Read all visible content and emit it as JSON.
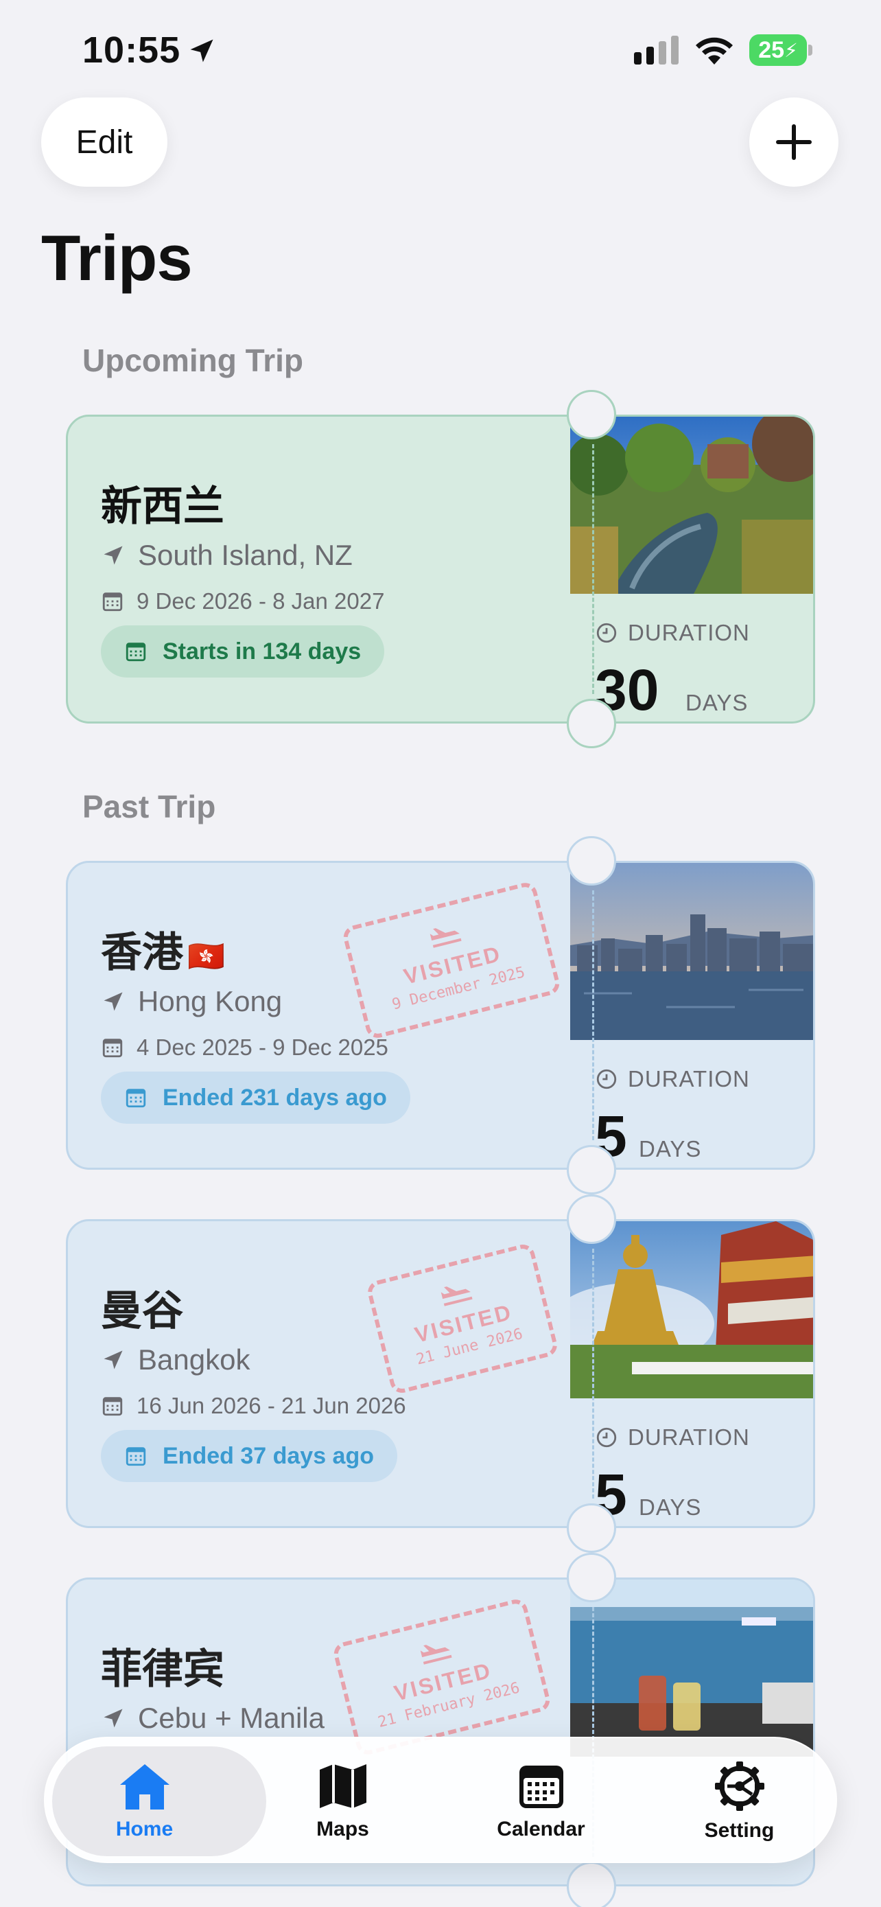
{
  "status_bar": {
    "time": "10:55",
    "battery": "25"
  },
  "header": {
    "edit_label": "Edit",
    "title": "Trips"
  },
  "sections": {
    "upcoming": "Upcoming Trip",
    "past": "Past Trip"
  },
  "upcoming_trip": {
    "name": "新西兰",
    "location": "South Island, NZ",
    "dates": "9 Dec 2026 - 8 Jan 2027",
    "status": "Starts in 134 days",
    "duration_label": "DURATION",
    "duration_value": "30",
    "duration_unit": "DAYS"
  },
  "past_trips": [
    {
      "name": "香港",
      "flag": "🇭🇰",
      "location": "Hong Kong",
      "dates": "4 Dec 2025 - 9 Dec 2025",
      "status": "Ended 231 days ago",
      "stamp_title": "VISITED",
      "stamp_date": "9 December 2025",
      "duration_label": "DURATION",
      "duration_value": "5",
      "duration_unit": "DAYS"
    },
    {
      "name": "曼谷",
      "location": "Bangkok",
      "dates": "16 Jun 2026 - 21 Jun 2026",
      "status": "Ended 37 days ago",
      "stamp_title": "VISITED",
      "stamp_date": "21 June 2026",
      "duration_label": "DURATION",
      "duration_value": "5",
      "duration_unit": "DAYS"
    },
    {
      "name": "菲律宾",
      "location": "Cebu + Manila",
      "stamp_title": "VISITED",
      "stamp_date": "21 February 2026"
    }
  ],
  "tab_bar": {
    "tabs": [
      {
        "label": "Home",
        "icon": "house-icon"
      },
      {
        "label": "Maps",
        "icon": "map-icon"
      },
      {
        "label": "Calendar",
        "icon": "calendar-icon"
      },
      {
        "label": "Setting",
        "icon": "gear-icon"
      }
    ]
  },
  "colors": {
    "accent": "#1a7cf3",
    "upcoming_bg": "#d7ebe1",
    "upcoming_text": "#1e7a4a",
    "past_bg": "#dde9f4",
    "past_text": "#3a9ad0",
    "stamp": "#e7a2ac"
  }
}
